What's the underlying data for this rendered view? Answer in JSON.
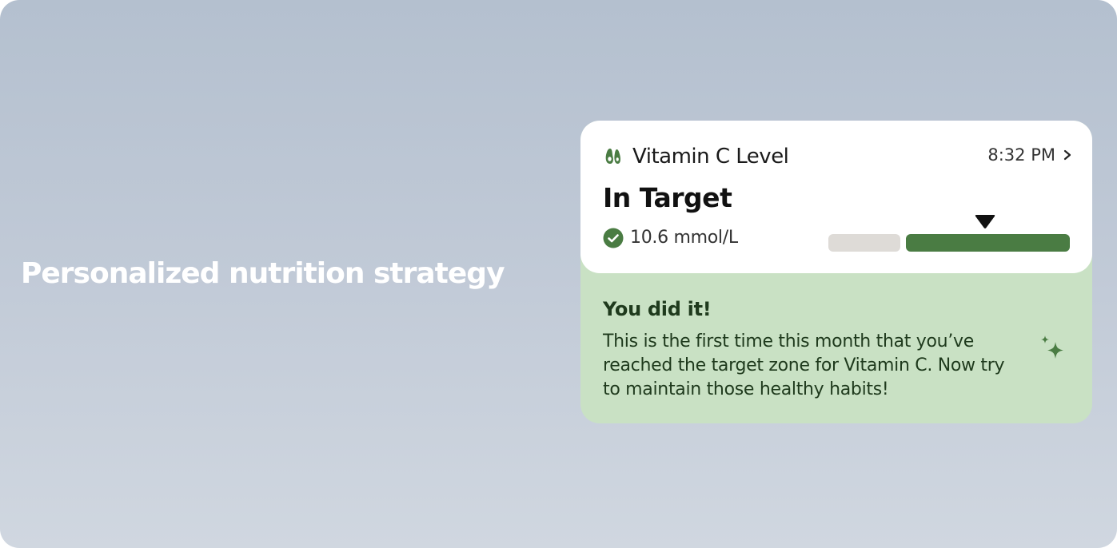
{
  "headline": "Personalized nutrition strategy",
  "card": {
    "icon": "avocado-icon",
    "metric_title": "Vitamin C Level",
    "time": "8:32 PM",
    "status": "In Target",
    "status_icon": "check-circle-icon",
    "value": "10.6 mmol/L",
    "range": {
      "segments": [
        "below-target",
        "in-target"
      ],
      "marker_fraction": 0.65,
      "colors": {
        "below": "#dedbd7",
        "target": "#4a7c43",
        "marker": "#111111"
      }
    },
    "message": {
      "title": "You did it!",
      "body": "This is the first time this month that you’ve reached the target zone for Vitamin C. Now try to maintain those healthy habits!",
      "icon": "sparkle-icon"
    }
  },
  "colors": {
    "accent": "#4a7c43",
    "message_bg": "#c9e1c4",
    "card_bg": "#ffffff",
    "page_bg_top": "#b4c0cf",
    "page_bg_bottom": "#d0d7e0"
  }
}
